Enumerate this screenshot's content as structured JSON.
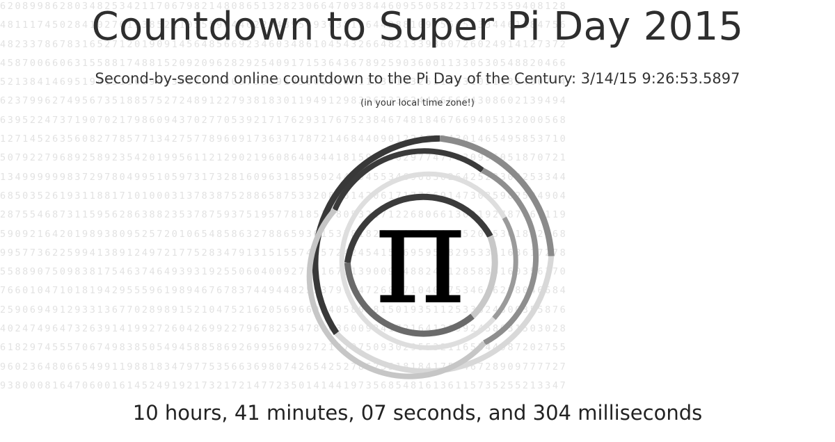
{
  "header": {
    "title": "Countdown to Super Pi Day 2015",
    "subtitle": "Second-by-second online countdown to the Pi Day of the Century: 3/14/15 9:26:53.5897",
    "timezone_note": "(in your local time zone!)"
  },
  "graphic": {
    "symbol": "π",
    "icon": "pi-symbol-with-concentric-ring-icon",
    "colors": {
      "rings": [
        "#383838",
        "#8a8a8a",
        "#bcbcbc",
        "#dcdcdc",
        "#555555"
      ],
      "digits": "#e2e2e2"
    }
  },
  "countdown": {
    "text": "10 hours, 41 minutes, 07 seconds, and 304 milliseconds"
  },
  "background_digits": [
    "6208998628034825342117067982148086513282306647093844609550582231725359408128",
    "4811174502841027019385211055596446229489549303819644288109756659334461284756",
    "4823378678316527120190914564856692346034861045432664821339360726024914127372",
    "4587006606315588174881520920962829254091715364367892590360011330530548820466",
    "5213841469519415116094330572703657595919530921861173819326117931051185480744",
    "6237996274956735188575272489122793818301194912983367336244065664308602139494",
    "6395224737190702179860943702770539217176293176752384674818467669405132000568",
    "1271452635608277857713427577896091736371787214684409012249534301465495853710",
    "5079227968925892354201995611212902196086403441815981362977477130996051870721",
    "1349999998372978049951059731732816096318595024459455346908302642522308253344",
    "6850352619311881710100031378387528865875332083814206171776691473035982534904",
    "2875546873115956286388235378759375195778185778053217122680661300192787661119",
    "5909216420198938095257201065485863278865936153381827968230301952035301852968",
    "9957736225994138912497217752834791315155748572424541506959508295331168617278",
    "5588907509838175463746493931925506040092770167113900984882401285836160356370",
    "7660104710181942955596198946767837449448255379774726847104047534646208046684",
    "2590694912933136770289891521047521620569660240580381501935112533824300355876",
    "4024749647326391419927260426992279678235478163600934172164121992458631503028",
    "6182974555706749838505494588586926995690927210797509302955321165344987202755",
    "9602364806654991198818347977535663698074265425278625518184175746728909777727",
    "9380008164706001614524919217321721477235014144197356854816136115735255213347"
  ]
}
